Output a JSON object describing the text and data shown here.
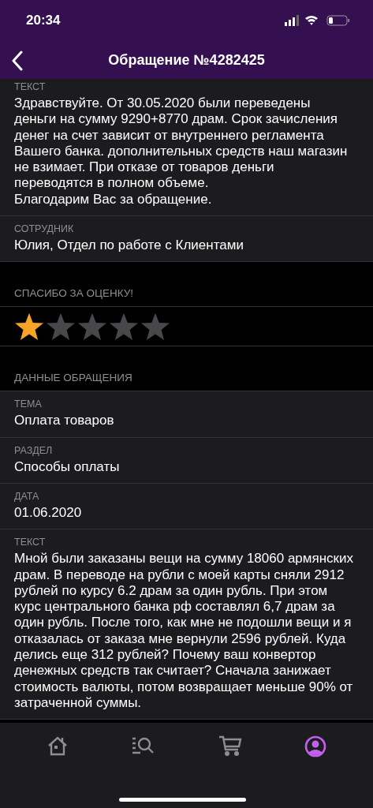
{
  "status_bar": {
    "time": "20:34"
  },
  "header": {
    "title": "Обращение №4282425"
  },
  "answer": {
    "fields": [
      {
        "label": "ТЕКСТ",
        "value": "Здравствуйте. От 30.05.2020 были переведены деньги на сумму 9290+8770 драм. Срок зачисления денег на счет зависит от внутреннего регламента Вашего банка. дополнительных средств наш магазин не взимает. При отказе от товаров деньги переводятся в полном объеме.\nБлагодарим Вас за обращение."
      },
      {
        "label": "СОТРУДНИК",
        "value": "Юлия, Отдел по работе с Клиентами"
      }
    ]
  },
  "rating": {
    "heading": "СПАСИБО ЗА ОЦЕНКУ!",
    "stars": 1
  },
  "request": {
    "heading": "ДАННЫЕ ОБРАЩЕНИЯ",
    "fields": [
      {
        "label": "ТЕМА",
        "value": "Оплата товаров"
      },
      {
        "label": "РАЗДЕЛ",
        "value": "Способы оплаты"
      },
      {
        "label": "ДАТА",
        "value": "01.06.2020"
      },
      {
        "label": "ТЕКСТ",
        "value": "Мной были заказаны вещи на сумму 18060 армянских драм. В переводе на рубли с моей карты сняли 2912 рублей по курсу 6.2 драм за один рубль. При этом курс центрального банка рф составлял 6,7 драм за один рубль. После того, как мне не подошли вещи и я отказалась от заказа мне вернули 2596 рублей. Куда делись еще 312 рублей? Почему ваш конвертор денежных средств так считает? Сначала занижает стоимость валюты, потом возвращает меньше 90% от затраченной суммы."
      }
    ]
  },
  "tab_bar": [
    {
      "kind": "home",
      "selected": false
    },
    {
      "kind": "search",
      "selected": false
    },
    {
      "kind": "cart",
      "selected": false
    },
    {
      "kind": "profile",
      "selected": true
    }
  ]
}
